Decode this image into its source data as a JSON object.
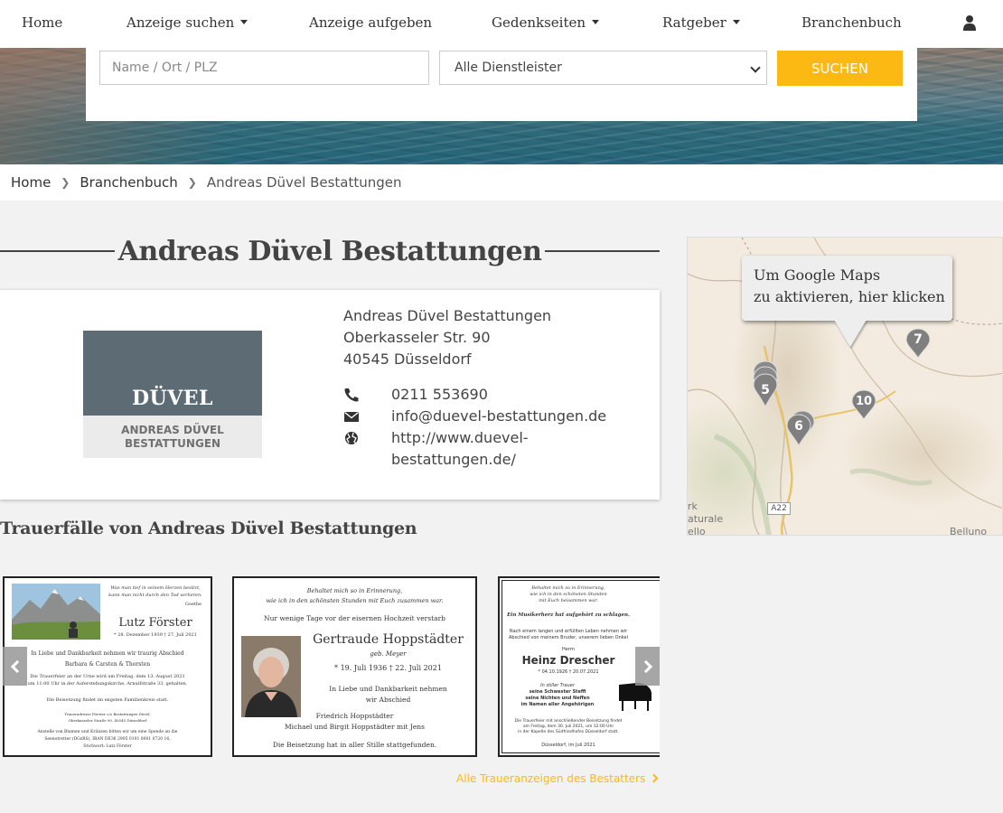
{
  "nav": {
    "items": [
      {
        "label": "Home",
        "dropdown": false
      },
      {
        "label": "Anzeige suchen",
        "dropdown": true
      },
      {
        "label": "Anzeige aufgeben",
        "dropdown": false
      },
      {
        "label": "Gedenkseiten",
        "dropdown": true
      },
      {
        "label": "Ratgeber",
        "dropdown": true
      },
      {
        "label": "Branchenbuch",
        "dropdown": false
      }
    ],
    "user_icon": "user-icon"
  },
  "search": {
    "placeholder": "Name / Ort / PLZ",
    "category_selected": "Alle Dienstleister",
    "button_label": "SUCHEN",
    "button_color": "#fdb913"
  },
  "breadcrumb": {
    "items": [
      "Home",
      "Branchenbuch"
    ],
    "current": "Andreas Düvel Bestattungen"
  },
  "page_title": "Andreas Düvel Bestattungen",
  "business": {
    "logo": {
      "word": "DÜVEL",
      "subline1": "ANDREAS DÜVEL",
      "subline2": "BESTATTUNGEN",
      "color": "#5d6b75"
    },
    "name": "Andreas Düvel Bestattungen",
    "street": "Oberkasseler Str. 90",
    "city": "40545 Düsseldorf",
    "phone": "0211 553690",
    "email": "info@duevel-bestattungen.de",
    "website_line1": "http://www.duevel-",
    "website_line2": "bestattungen.de/"
  },
  "map": {
    "tooltip_line1": "Um Google Maps",
    "tooltip_line2": "zu aktivieren, hier klicken",
    "markers": [
      "7",
      "5",
      "10",
      "6"
    ],
    "labels": {
      "label_a": "rk",
      "label_b": "aturale",
      "label_c": "ello",
      "road": "A22",
      "city": "Belluno"
    }
  },
  "obituaries": {
    "section_title": "Trauerfälle von Andreas Düvel Bestattungen",
    "all_link": "Alle Traueranzeigen des Bestatters",
    "cards": [
      {
        "quote1": "Was man tief in seinem Herzen besitzt,",
        "quote2": "kann man nicht durch den Tod verlieren.",
        "quote_author": "Goethe",
        "name": "Lutz Förster",
        "dates": "* 28. Dezember 1939   † 27. Juli 2021",
        "mourning": "In Liebe und Dankbarkeit nehmen wir traurig Abschied",
        "family": "Barbara & Carsten & Thorsten",
        "line1": "Die Trauerfeier an der Urne wird am Freitag, dem 13. August 2021",
        "line2": "um 11:00 Uhr in der Auferstehungskirche, Arnulfstraße 33, gehalten.",
        "line3": "Die Beisetzung findet im engsten Familienkreis statt.",
        "line4": "Traueradresse Förster c/o Bestattungen Düvel,",
        "line5": "Oberkasseler Straße 90, 40545 Düsseldorf",
        "line6": "Anstelle von Blumen und Kränzen bitten wir um eine Spende an die",
        "line7": "Seenotretter (DGzRS), IBAN DE36 2905 0101 0001 0720 16,",
        "line8": "Stichwort: Lutz Förster"
      },
      {
        "quote1": "Behaltet mich so in Erinnerung,",
        "quote2": "wie ich in den schönsten Stunden mit Euch zusammen war.",
        "intro": "Nur wenige Tage vor der eisernen Hochzeit verstarb",
        "name": "Gertraude Hoppstädter",
        "maiden": "geb. Meyer",
        "dates": "* 19. Juli 1936   † 22. Juli 2021",
        "mourning1": "In Liebe und Dankbarkeit nehmen",
        "mourning2": "wir Abschied",
        "family1": "Friedrich Hoppstädter",
        "family2": "Michael und Birgit Hoppstädter mit Jens",
        "burial": "Die Beisetzung hat in aller Stille stattgefunden."
      },
      {
        "quote1": "Behaltet mich so in Erinnerung,",
        "quote2": "wie ich in den schönsten Stunden",
        "quote3": "mit Euch beisammen war.",
        "motto": "Ein Musikerherz hat aufgehört zu schlagen.",
        "intro1": "Nach einem langen und erfüllten Leben nehmen wir",
        "intro2": "Abschied von meinem Bruder, unserem lieben Onkel",
        "title": "Herrn",
        "name": "Heinz Drescher",
        "dates": "* 04.10.1926   † 20.07.2021",
        "grief1": "In stiller Trauer",
        "grief2": "seine Schwester Steffi",
        "grief3": "seine Nichten und Neffen",
        "grief4": "im Namen aller Angehörigen",
        "info1": "Die Trauerfeier mit anschließender Beisetzung findet",
        "info2": "am Freitag, dem 30. Juli 2021, um 12:00 Uhr",
        "info3": "in der Kapelle des Südfriedhofes Düsseldorf statt.",
        "place_date": "Düsseldorf, im Juli 2021"
      }
    ]
  }
}
